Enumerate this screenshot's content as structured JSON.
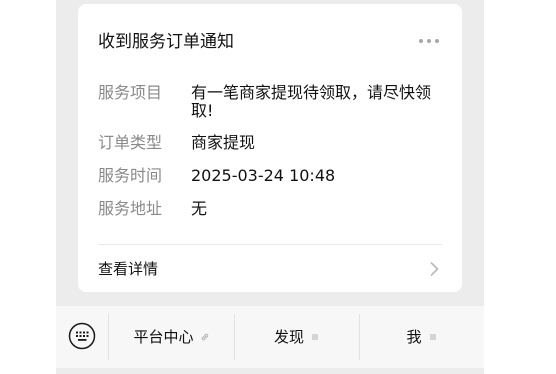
{
  "card": {
    "title": "收到服务订单通知",
    "more_icon": "more-dots-icon",
    "fields": [
      {
        "label": "服务项目",
        "value": "有一笔商家提现待领取，请尽快领取!"
      },
      {
        "label": "订单类型",
        "value": "商家提现"
      },
      {
        "label": "服务时间",
        "value": "2025-03-24 10:48"
      },
      {
        "label": "服务地址",
        "value": "无"
      }
    ],
    "details_label": "查看详情",
    "details_icon": "chevron-right-icon"
  },
  "bottom_bar": {
    "keyboard_icon": "keyboard-icon",
    "menus": [
      {
        "label": "平台中心",
        "icon": "link-icon"
      },
      {
        "label": "发现",
        "icon": "menu-lines-icon"
      },
      {
        "label": "我",
        "icon": "menu-lines-icon"
      }
    ]
  }
}
